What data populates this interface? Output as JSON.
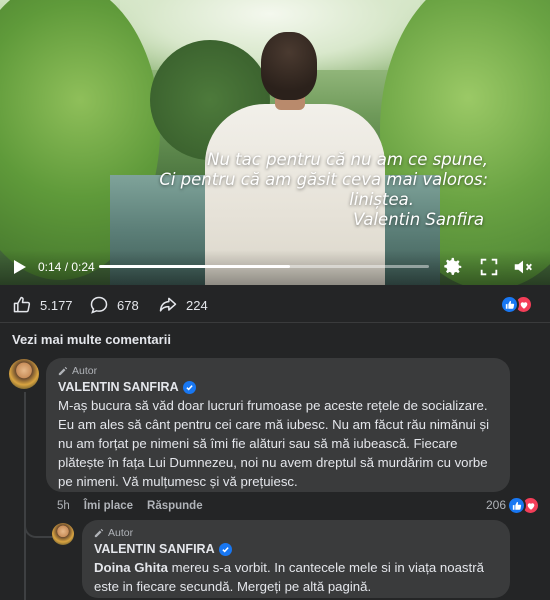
{
  "video": {
    "quote_lines": [
      "Nu tac pentru că nu am ce spune,",
      "Ci pentru că am găsit ceva mai valoros:",
      "liniștea.",
      "Valentin Sanfira"
    ],
    "time_display": "0:14 / 0:24",
    "progress_fraction": 0.58
  },
  "stats": {
    "likes": "5.177",
    "comments": "678",
    "shares": "224",
    "reaction_colors": {
      "like": "#1877f2",
      "love": "#f33e58"
    }
  },
  "more_comments_label": "Vezi mai multe comentarii",
  "comments": [
    {
      "author_badge": "Autor",
      "author": "VALENTIN SANFIRA",
      "text": "M-aș bucura să văd doar lucruri frumoase pe aceste rețele de socializare. Eu am ales să cânt pentru cei care mă iubesc. Nu am făcut rău nimănui și nu am forțat pe nimeni să îmi fie alături sau să mă iubească. Fiecare plătește în fața Lui Dumnezeu, noi nu avem dreptul să murdărim cu vorbe pe nimeni. Vă mulțumesc și vă prețuiesc.",
      "age": "5h",
      "like_label": "Îmi place",
      "reply_label": "Răspunde",
      "reaction_count": "206"
    },
    {
      "author_badge": "Autor",
      "author": "VALENTIN SANFIRA",
      "mention": "Doina Ghita",
      "text": " mereu s-a vorbit. In cantecele mele si in viața noastră este in fiecare secundă. Mergeți pe altă pagină."
    }
  ]
}
